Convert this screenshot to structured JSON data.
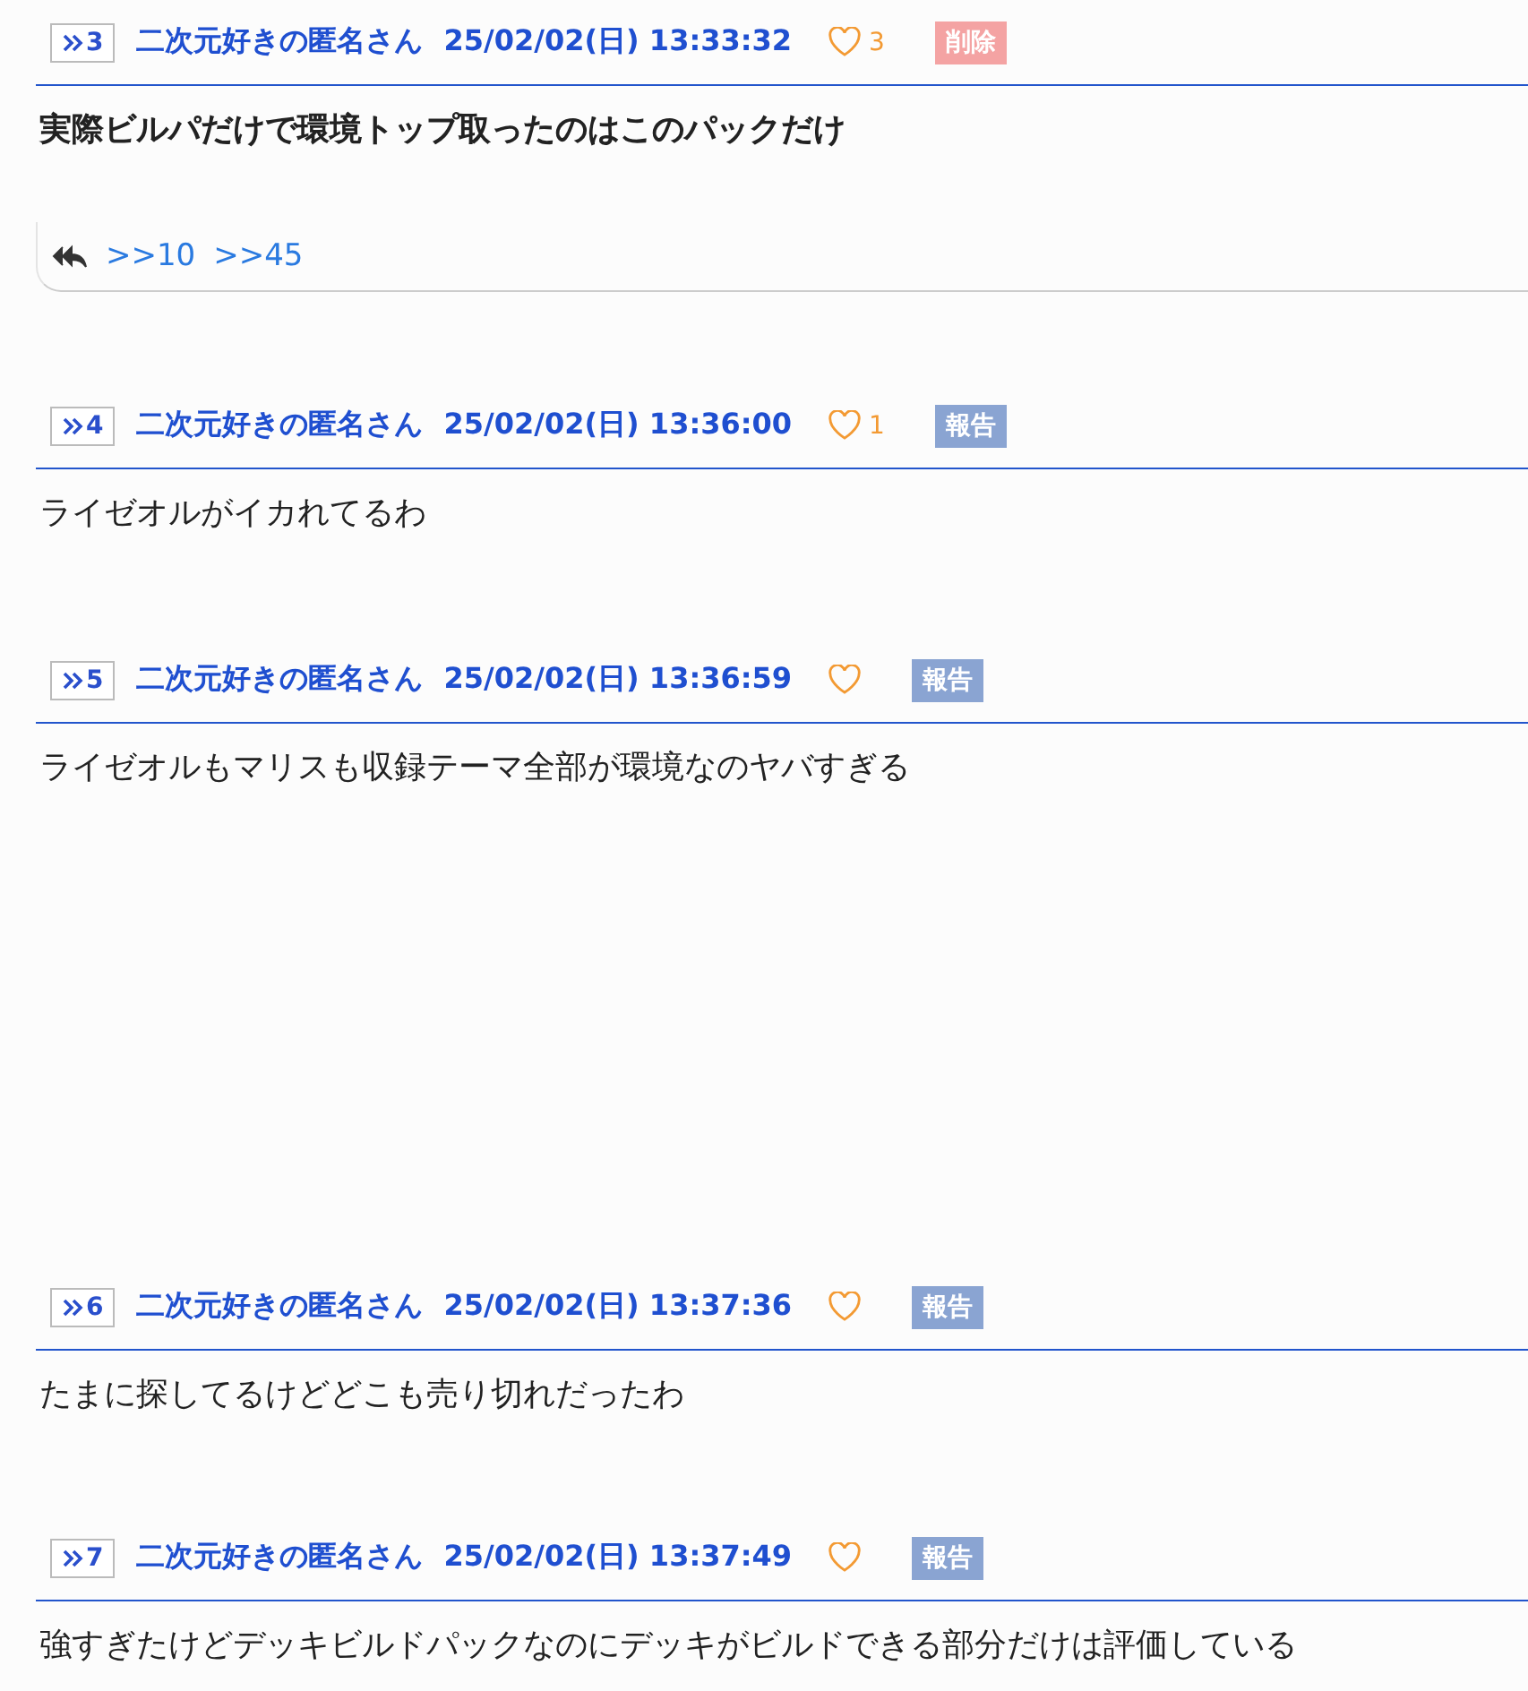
{
  "posts": [
    {
      "number": "3",
      "name": "二次元好きの匿名さん",
      "date": "25/02/02(日) 13:33:32",
      "likes": "3",
      "action": {
        "kind": "delete",
        "label": "削除"
      },
      "body": "実際ビルパだけで環境トップ取ったのはこのパックだけ",
      "bold": true,
      "replies": [
        ">>10",
        ">>45"
      ]
    },
    {
      "number": "4",
      "name": "二次元好きの匿名さん",
      "date": "25/02/02(日) 13:36:00",
      "likes": "1",
      "action": {
        "kind": "report",
        "label": "報告"
      },
      "body": "ライゼオルがイカれてるわ",
      "bold": false
    },
    {
      "number": "5",
      "name": "二次元好きの匿名さん",
      "date": "25/02/02(日) 13:36:59",
      "action": {
        "kind": "report",
        "label": "報告"
      },
      "body": "ライゼオルもマリスも収録テーマ全部が環境なのヤバすぎる",
      "bold": false
    },
    {
      "number": "6",
      "name": "二次元好きの匿名さん",
      "date": "25/02/02(日) 13:37:36",
      "action": {
        "kind": "report",
        "label": "報告"
      },
      "body": "たまに探してるけどどこも売り切れだったわ",
      "bold": false
    },
    {
      "number": "7",
      "name": "二次元好きの匿名さん",
      "date": "25/02/02(日) 13:37:49",
      "action": {
        "kind": "report",
        "label": "報告"
      },
      "body": "強すぎたけどデッキビルドパックなのにデッキがビルドできる部分だけは評価している",
      "bold": false
    }
  ]
}
